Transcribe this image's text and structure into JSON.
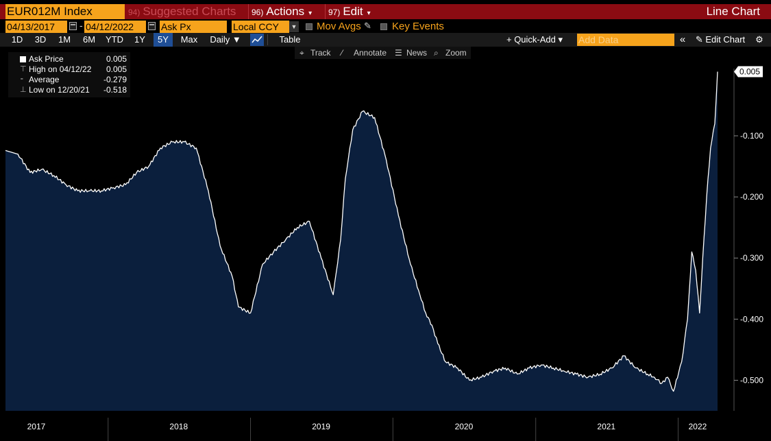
{
  "header": {
    "security": "EUR012M Index",
    "suggested": {
      "num": "94)",
      "label": "Suggested Charts"
    },
    "actions": {
      "num": "96)",
      "label": "Actions"
    },
    "edit": {
      "num": "97)",
      "label": "Edit"
    },
    "chart_type": "Line Chart",
    "caret": "▾"
  },
  "options": {
    "start_date": "04/13/2017",
    "date_separator": "-",
    "end_date": "04/12/2022",
    "field": "Ask Px",
    "currency": "Local CCY",
    "mov_avgs": "Mov Avgs",
    "key_events": "Key Events"
  },
  "toolbar": {
    "ranges": [
      "1D",
      "3D",
      "1M",
      "6M",
      "YTD",
      "1Y",
      "5Y",
      "Max"
    ],
    "active_range": "5Y",
    "frequency": "Daily ▼",
    "table": "Table",
    "quick_add": "+ Quick-Add ▾",
    "add_data_placeholder": "Add Data",
    "collapse": "«",
    "edit_chart": "✎ Edit Chart",
    "settings": "⚙"
  },
  "chart_tools": {
    "track": "Track",
    "annotate": "Annotate",
    "news": "News",
    "zoom": "Zoom"
  },
  "legend": {
    "series": {
      "label": "Ask Price",
      "value": "0.005"
    },
    "high": {
      "label": "High on 04/12/22",
      "value": "0.005"
    },
    "average": {
      "label": "Average",
      "value": "-0.279"
    },
    "low": {
      "label": "Low on 12/20/21",
      "value": "-0.518"
    }
  },
  "colors": {
    "line": "#ffffff",
    "fill": "#0b1f3d",
    "accent": "#f6a31c",
    "title_bar": "#8b0b12"
  },
  "chart_data": {
    "type": "area",
    "ylim": [
      -0.55,
      0.01
    ],
    "yticks": [
      -0.5,
      -0.4,
      -0.3,
      -0.2,
      -0.1
    ],
    "ytick_labels": [
      "-0.500",
      "-0.400",
      "-0.300",
      "-0.200",
      "-0.100"
    ],
    "last_value_label": "0.005",
    "xlim": [
      "2017-04-13",
      "2022-04-12"
    ],
    "x_labels": [
      {
        "label": "2017",
        "date": "2017-07-01"
      },
      {
        "label": "2018",
        "date": "2018-07-01"
      },
      {
        "label": "2019",
        "date": "2019-07-01"
      },
      {
        "label": "2020",
        "date": "2020-07-01"
      },
      {
        "label": "2021",
        "date": "2021-07-01"
      },
      {
        "label": "2022",
        "date": "2022-02-20"
      }
    ],
    "year_starts": [
      "2018-01-01",
      "2019-01-01",
      "2020-01-01",
      "2021-01-01",
      "2022-01-01"
    ],
    "series": [
      {
        "name": "Ask Price",
        "x": [
          "2017-04-13",
          "2017-05-15",
          "2017-06-15",
          "2017-07-15",
          "2017-08-15",
          "2017-09-15",
          "2017-10-15",
          "2017-11-15",
          "2017-12-15",
          "2018-01-15",
          "2018-02-15",
          "2018-03-15",
          "2018-04-15",
          "2018-05-15",
          "2018-06-15",
          "2018-07-15",
          "2018-08-15",
          "2018-09-15",
          "2018-10-15",
          "2018-11-15",
          "2018-12-01",
          "2019-01-01",
          "2019-02-01",
          "2019-03-01",
          "2019-04-01",
          "2019-05-01",
          "2019-06-01",
          "2019-07-01",
          "2019-08-01",
          "2019-08-20",
          "2019-09-01",
          "2019-09-20",
          "2019-10-15",
          "2019-11-15",
          "2019-12-15",
          "2020-01-15",
          "2020-02-15",
          "2020-03-10",
          "2020-03-25",
          "2020-04-10",
          "2020-04-25",
          "2020-05-15",
          "2020-06-15",
          "2020-07-15",
          "2020-08-15",
          "2020-09-15",
          "2020-10-15",
          "2020-11-15",
          "2020-12-15",
          "2021-01-15",
          "2021-02-15",
          "2021-03-15",
          "2021-04-15",
          "2021-05-15",
          "2021-06-15",
          "2021-07-15",
          "2021-08-15",
          "2021-09-15",
          "2021-10-15",
          "2021-11-01",
          "2021-11-20",
          "2021-12-05",
          "2021-12-20",
          "2022-01-10",
          "2022-01-25",
          "2022-02-05",
          "2022-02-15",
          "2022-02-25",
          "2022-03-05",
          "2022-03-15",
          "2022-03-25",
          "2022-04-05",
          "2022-04-12"
        ],
        "y": [
          -0.124,
          -0.13,
          -0.16,
          -0.155,
          -0.165,
          -0.18,
          -0.19,
          -0.19,
          -0.19,
          -0.185,
          -0.18,
          -0.16,
          -0.15,
          -0.12,
          -0.11,
          -0.11,
          -0.12,
          -0.19,
          -0.28,
          -0.33,
          -0.38,
          -0.39,
          -0.31,
          -0.29,
          -0.27,
          -0.25,
          -0.24,
          -0.3,
          -0.36,
          -0.27,
          -0.17,
          -0.09,
          -0.06,
          -0.07,
          -0.14,
          -0.23,
          -0.31,
          -0.36,
          -0.39,
          -0.41,
          -0.44,
          -0.47,
          -0.48,
          -0.5,
          -0.495,
          -0.485,
          -0.48,
          -0.49,
          -0.48,
          -0.475,
          -0.48,
          -0.485,
          -0.49,
          -0.495,
          -0.49,
          -0.48,
          -0.46,
          -0.48,
          -0.49,
          -0.495,
          -0.505,
          -0.495,
          -0.518,
          -0.47,
          -0.4,
          -0.29,
          -0.32,
          -0.39,
          -0.3,
          -0.2,
          -0.12,
          -0.08,
          0.005
        ]
      }
    ]
  }
}
